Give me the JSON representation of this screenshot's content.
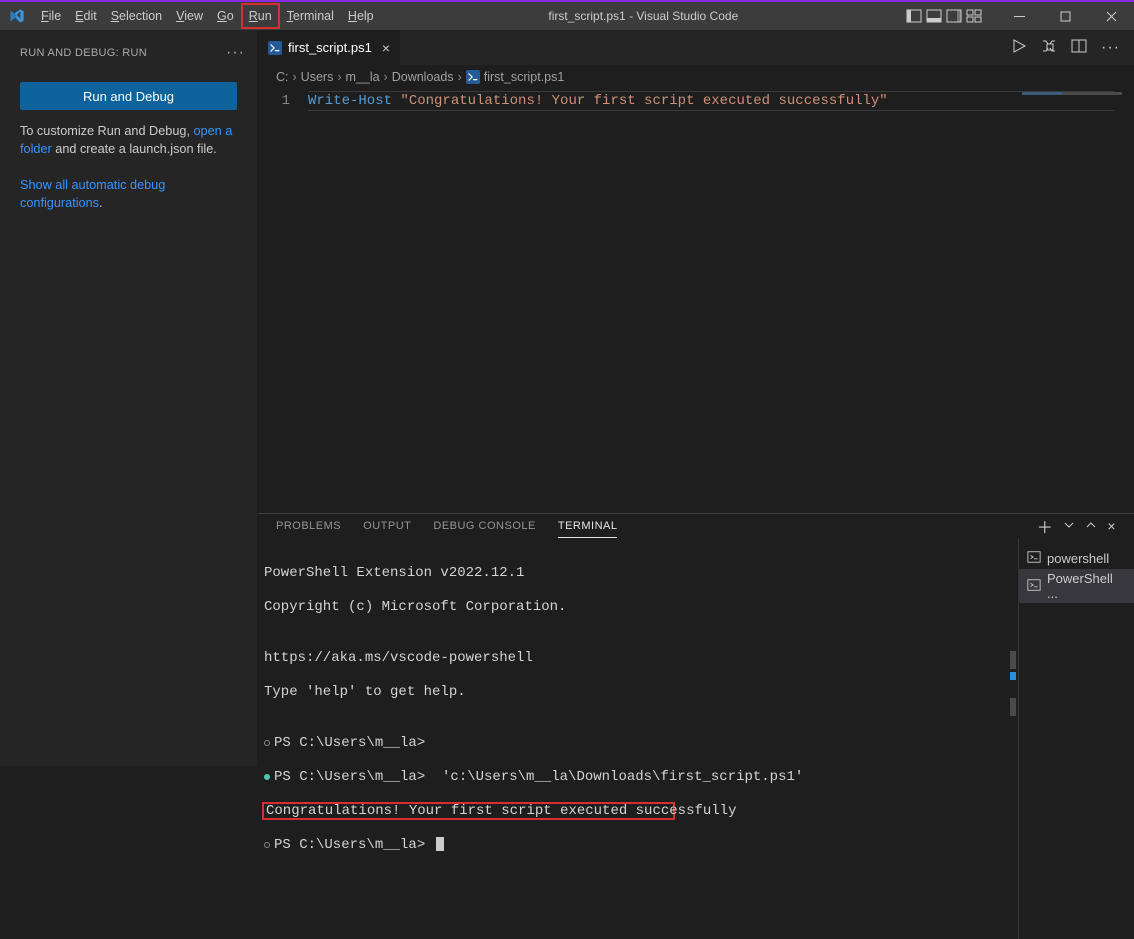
{
  "menus": {
    "file": "File",
    "edit": "Edit",
    "selection": "Selection",
    "view": "View",
    "go": "Go",
    "run": "Run",
    "terminal": "Terminal",
    "help": "Help"
  },
  "title": "first_script.ps1 - Visual Studio Code",
  "sidebar": {
    "header": "RUN AND DEBUG: RUN",
    "run_button": "Run and Debug",
    "customize_pre": "To customize Run and Debug, ",
    "customize_link": "open a folder",
    "customize_post": " and create a launch.json file.",
    "show_link": "Show all automatic debug configurations",
    "show_post": "."
  },
  "tab": {
    "filename": "first_script.ps1"
  },
  "breadcrumbs": {
    "c": "C:",
    "users": "Users",
    "user": "m__la",
    "downloads": "Downloads",
    "file": "first_script.ps1"
  },
  "editor": {
    "line_number": "1",
    "cmd": "Write-Host",
    "string": "\"Congratulations! Your first script executed successfully\""
  },
  "panel": {
    "tabs": {
      "problems": "PROBLEMS",
      "output": "OUTPUT",
      "debug": "DEBUG CONSOLE",
      "terminal": "TERMINAL"
    },
    "terminal_sessions": {
      "powershell": "powershell",
      "psext": "PowerShell ..."
    },
    "lines": {
      "l1": "PowerShell Extension v2022.12.1",
      "l2": "Copyright (c) Microsoft Corporation.",
      "l3": "",
      "l4": "https://aka.ms/vscode-powershell",
      "l5": "Type 'help' to get help.",
      "l6": "",
      "l7": "PS C:\\Users\\m__la>",
      "l8": "PS C:\\Users\\m__la>  'c:\\Users\\m__la\\Downloads\\first_script.ps1'",
      "l9": "Congratulations! Your first script executed successfully",
      "l10": "PS C:\\Users\\m__la> "
    }
  }
}
